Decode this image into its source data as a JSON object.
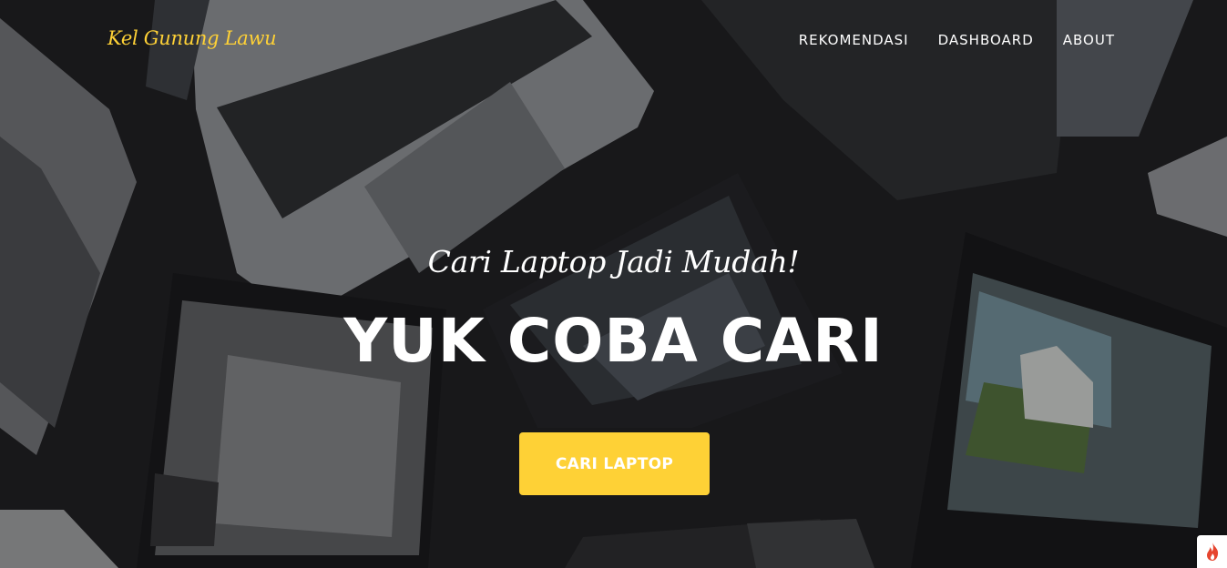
{
  "colors": {
    "accent": "#fed136",
    "text": "#ffffff",
    "background": "#1e1e21"
  },
  "navbar": {
    "brand": "Kel Gunung Lawu",
    "links": [
      "REKOMENDASI",
      "DASHBOARD",
      "ABOUT"
    ]
  },
  "hero": {
    "subtitle": "Cari Laptop Jadi Mudah!",
    "title": "YUK COBA CARI",
    "button_label": "CARI LAPTOP",
    "background_icon": "laptops-photo"
  },
  "corner_badge": {
    "icon": "flame-icon"
  }
}
